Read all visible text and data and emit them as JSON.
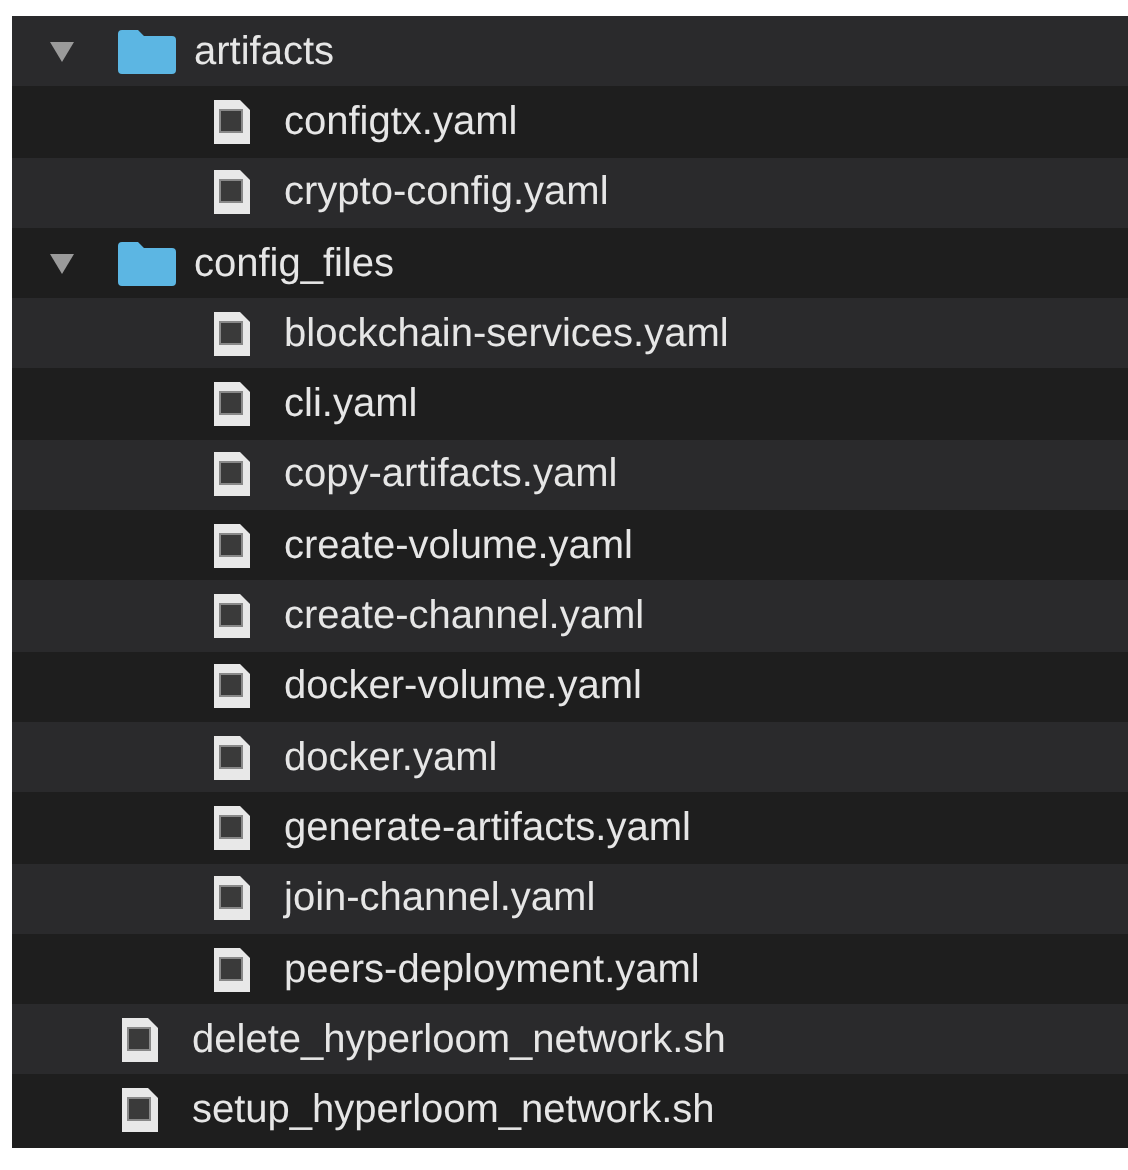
{
  "tree": [
    {
      "kind": "folder",
      "name": "artifacts",
      "expanded": true,
      "children": [
        {
          "kind": "file",
          "name": "configtx.yaml"
        },
        {
          "kind": "file",
          "name": "crypto-config.yaml"
        }
      ]
    },
    {
      "kind": "folder",
      "name": "config_files",
      "expanded": true,
      "children": [
        {
          "kind": "file",
          "name": "blockchain-services.yaml"
        },
        {
          "kind": "file",
          "name": "cli.yaml"
        },
        {
          "kind": "file",
          "name": "copy-artifacts.yaml"
        },
        {
          "kind": "file",
          "name": "create-volume.yaml"
        },
        {
          "kind": "file",
          "name": "create-channel.yaml"
        },
        {
          "kind": "file",
          "name": "docker-volume.yaml"
        },
        {
          "kind": "file",
          "name": "docker.yaml"
        },
        {
          "kind": "file",
          "name": "generate-artifacts.yaml"
        },
        {
          "kind": "file",
          "name": "join-channel.yaml"
        },
        {
          "kind": "file",
          "name": "peers-deployment.yaml"
        }
      ]
    },
    {
      "kind": "file",
      "name": "delete_hyperloom_network.sh"
    },
    {
      "kind": "file",
      "name": "setup_hyperloom_network.sh"
    }
  ]
}
